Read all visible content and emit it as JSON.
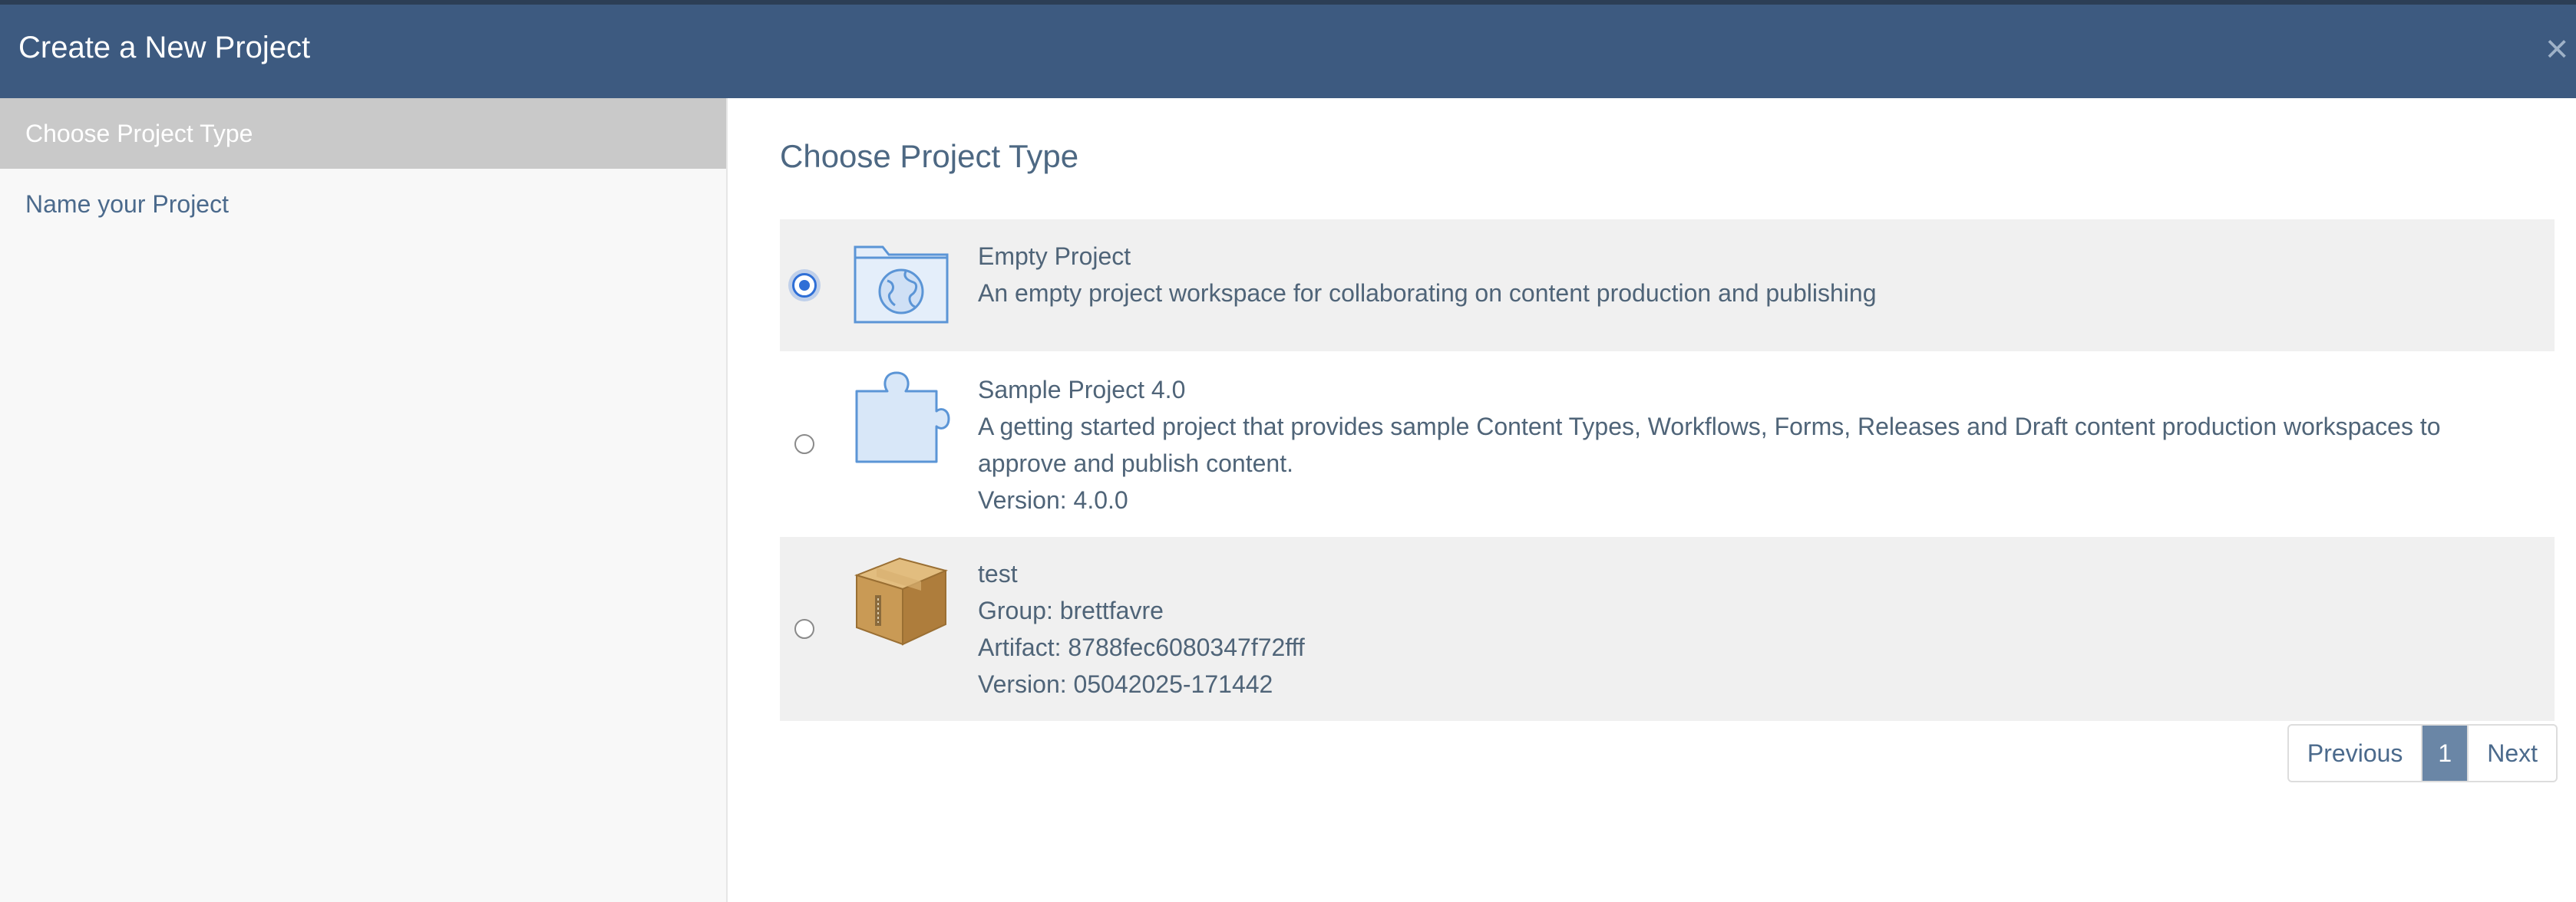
{
  "dialog": {
    "title": "Create a New Project",
    "close_glyph": "×"
  },
  "sidebar": {
    "steps": [
      {
        "label": "Choose Project Type",
        "active": true
      },
      {
        "label": "Name your Project",
        "active": false
      }
    ]
  },
  "main": {
    "title": "Choose Project Type",
    "options": [
      {
        "name": "Empty Project",
        "description": "An empty project workspace for collaborating on content production and publishing",
        "icon": "folder-globe-icon",
        "selected": true
      },
      {
        "name": "Sample Project 4.0",
        "description_line1": "A getting started project that provides sample Content Types, Workflows, Forms, Releases and Draft content production workspaces to",
        "description_line2": "approve and publish content.",
        "version": "Version: 4.0.0",
        "icon": "puzzle-piece-icon",
        "selected": false
      },
      {
        "name": "test",
        "group": "Group: brettfavre",
        "artifact": "Artifact: 8788fec6080347f72fff",
        "version": "Version: 05042025-171442",
        "icon": "package-box-icon",
        "selected": false
      }
    ],
    "pagination": {
      "previous": "Previous",
      "current": "1",
      "next": "Next"
    }
  },
  "colors": {
    "header": "#3d5a80",
    "sidebar_active": "#c9c9c9",
    "text": "#4f6478",
    "radio_accent": "#2f6fd6",
    "page_active": "#6a86a6"
  }
}
